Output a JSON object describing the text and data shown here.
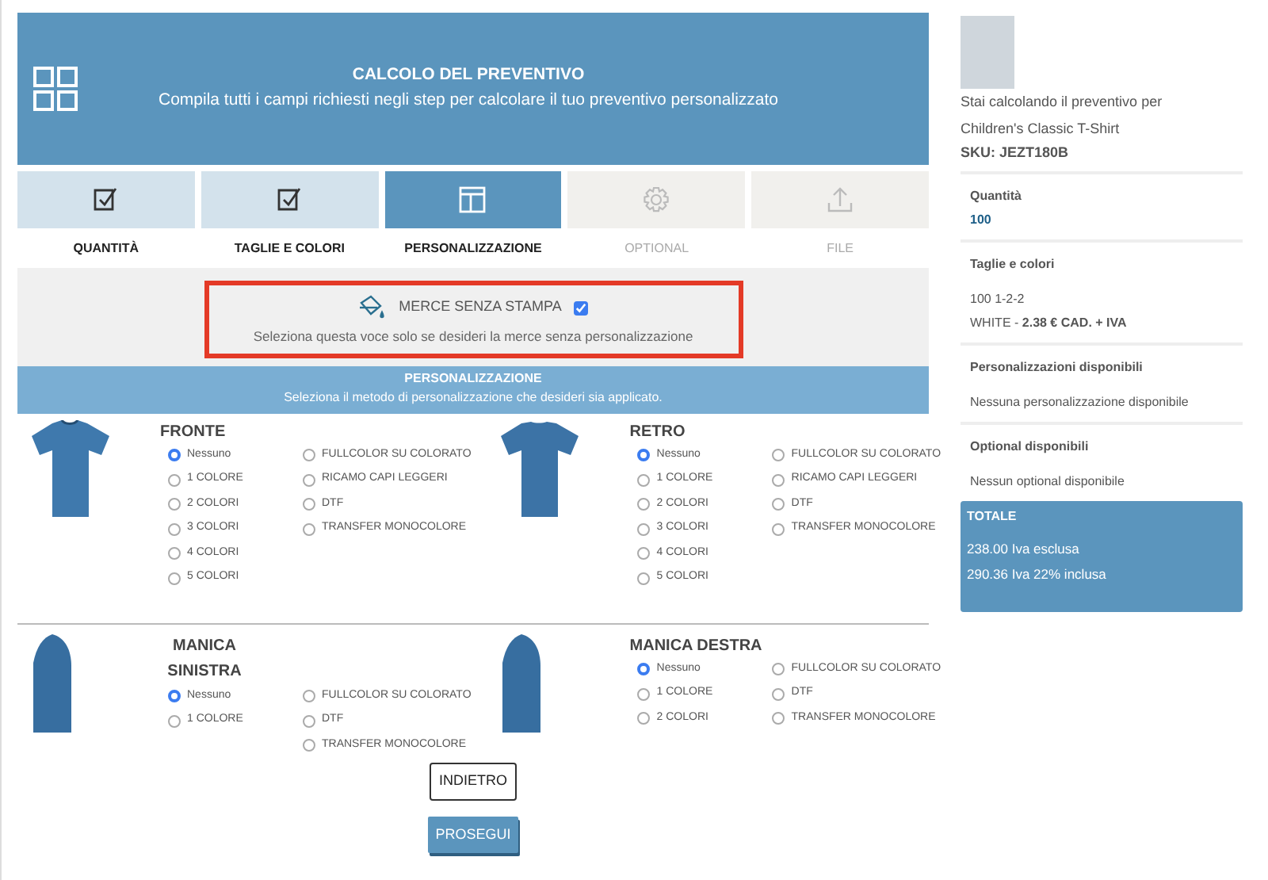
{
  "header": {
    "title": "CALCOLO DEL PREVENTIVO",
    "subtitle": "Compila tutti i campi richiesti negli step per calcolare il tuo preventivo personalizzato"
  },
  "steps": [
    {
      "label": "QUANTITÀ",
      "kind": "check",
      "selected": false,
      "disabled": false
    },
    {
      "label": "TAGLIE E COLORI",
      "kind": "check",
      "selected": false,
      "disabled": false
    },
    {
      "label": "PERSONALIZZAZIONE",
      "kind": "layout",
      "selected": true,
      "disabled": false
    },
    {
      "label": "OPTIONAL",
      "kind": "gear",
      "selected": false,
      "disabled": true
    },
    {
      "label": "FILE",
      "kind": "upload",
      "selected": false,
      "disabled": true
    }
  ],
  "no_print": {
    "label": "MERCE SENZA STAMPA",
    "checked": true,
    "hint": "Seleziona questa voce solo se desideri la merce senza personalizzazione"
  },
  "personalization_bar": {
    "title": "PERSONALIZZAZIONE",
    "subtitle": "Seleziona il metodo di personalizzazione che desideri sia applicato."
  },
  "placements": [
    {
      "name": "FRONTE",
      "kind": "front",
      "columns": [
        [
          {
            "label": "Nessuno",
            "selected": true
          },
          {
            "label": "1 COLORE",
            "selected": false
          },
          {
            "label": "2 COLORI",
            "selected": false
          },
          {
            "label": "3 COLORI",
            "selected": false
          },
          {
            "label": "4 COLORI",
            "selected": false
          },
          {
            "label": "5 COLORI",
            "selected": false
          }
        ],
        [
          {
            "label": "FULLCOLOR SU COLORATO",
            "selected": false
          },
          {
            "label": "RICAMO CAPI LEGGERI",
            "selected": false
          },
          {
            "label": "DTF",
            "selected": false
          },
          {
            "label": "TRANSFER MONOCOLORE",
            "selected": false
          }
        ]
      ]
    },
    {
      "name": "RETRO",
      "kind": "back",
      "columns": [
        [
          {
            "label": "Nessuno",
            "selected": true
          },
          {
            "label": "1 COLORE",
            "selected": false
          },
          {
            "label": "2 COLORI",
            "selected": false
          },
          {
            "label": "3 COLORI",
            "selected": false
          },
          {
            "label": "4 COLORI",
            "selected": false
          },
          {
            "label": "5 COLORI",
            "selected": false
          }
        ],
        [
          {
            "label": "FULLCOLOR SU COLORATO",
            "selected": false
          },
          {
            "label": "RICAMO CAPI LEGGERI",
            "selected": false
          },
          {
            "label": "DTF",
            "selected": false
          },
          {
            "label": "TRANSFER MONOCOLORE",
            "selected": false
          }
        ]
      ]
    },
    {
      "name": "MANICA SINISTRA",
      "kind": "sleeve",
      "columns": [
        [
          {
            "label": "Nessuno",
            "selected": true
          },
          {
            "label": "1 COLORE",
            "selected": false
          }
        ],
        [
          {
            "label": "FULLCOLOR SU COLORATO",
            "selected": false
          },
          {
            "label": "DTF",
            "selected": false
          },
          {
            "label": "TRANSFER MONOCOLORE",
            "selected": false
          }
        ]
      ]
    },
    {
      "name": "MANICA DESTRA",
      "kind": "sleeve",
      "columns": [
        [
          {
            "label": "Nessuno",
            "selected": true
          },
          {
            "label": "1 COLORE",
            "selected": false
          },
          {
            "label": "2 COLORI",
            "selected": false
          }
        ],
        [
          {
            "label": "FULLCOLOR SU COLORATO",
            "selected": false
          },
          {
            "label": "DTF",
            "selected": false
          },
          {
            "label": "TRANSFER MONOCOLORE",
            "selected": false
          }
        ]
      ]
    }
  ],
  "buttons": {
    "back": "INDIETRO",
    "next": "PROSEGUI"
  },
  "summary": {
    "intro": "Stai calcolando il preventivo per",
    "product": "Children's Classic T-Shirt",
    "sku": "SKU: JEZT180B",
    "sections": [
      {
        "title": "Quantità",
        "lines": [
          "100"
        ],
        "kind": "value"
      },
      {
        "title": "Taglie e colori",
        "lines": [
          "100 1-2-2",
          "WHITE - **2.38 € CAD. + IVA**"
        ],
        "kind": "text"
      },
      {
        "title": "Personalizzazioni disponibili",
        "lines": [
          "Nessuna personalizzazione disponibile"
        ],
        "kind": "text"
      },
      {
        "title": "Optional disponibili",
        "lines": [
          "Nessun optional disponibile"
        ],
        "kind": "text"
      }
    ],
    "total": {
      "title": "TOTALE",
      "lines": [
        "238.00 Iva esclusa",
        "290.36 Iva 22% inclusa"
      ]
    }
  }
}
